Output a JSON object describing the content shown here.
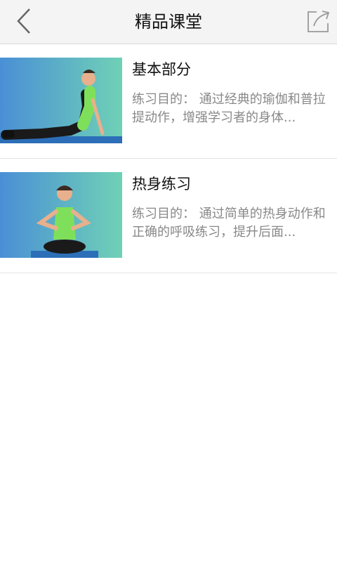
{
  "header": {
    "title": "精品课堂",
    "back_icon": "chevron-left-icon",
    "share_icon": "share-external-icon"
  },
  "courses": [
    {
      "title": "基本部分",
      "description": "练习目的： 通过经典的瑜伽和普拉提动作，增强学习者的身体...",
      "thumbnail": "yoga-cobra-pose-thumbnail"
    },
    {
      "title": "热身练习",
      "description": "练习目的： 通过简单的热身动作和正确的呼吸练习，提升后面...",
      "thumbnail": "yoga-seated-breathing-thumbnail"
    }
  ],
  "colors": {
    "header_bg": "#f4f4f4",
    "text_primary": "#111111",
    "text_secondary": "#888888",
    "thumb_gradient_start": "#4a8fd6",
    "thumb_gradient_end": "#6fd1b6"
  }
}
